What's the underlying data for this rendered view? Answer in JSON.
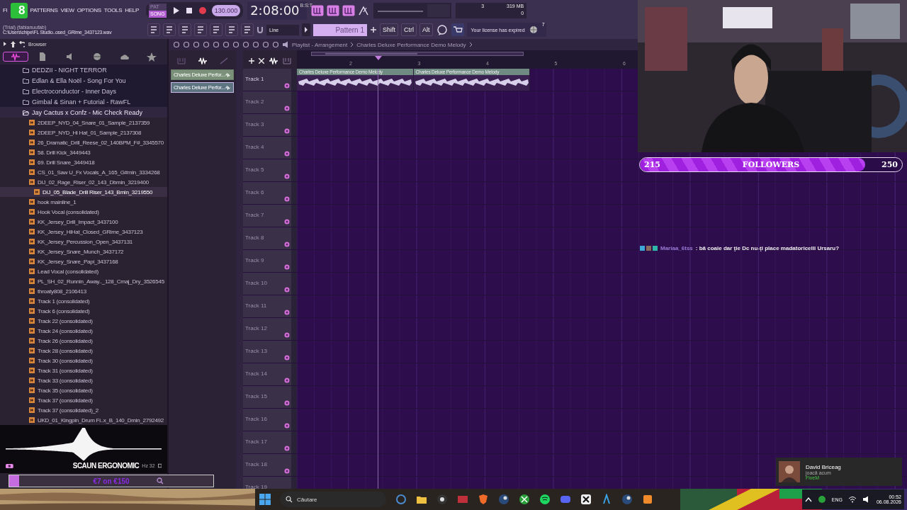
{
  "menu": {
    "items": [
      {
        "label": "FI"
      },
      {
        "label": "8",
        "kind": "logo"
      },
      {
        "label": "PATTERNS"
      },
      {
        "label": "VIEW"
      },
      {
        "label": "OPTIONS"
      },
      {
        "label": "TOOLS"
      },
      {
        "label": "HELP"
      }
    ]
  },
  "transport": {
    "modes": [
      {
        "label": "PAT",
        "selected": false
      },
      {
        "label": "SONG",
        "selected": true
      }
    ],
    "tempo": "130.000",
    "time": "2:08:00",
    "time_unit": "B:S:T"
  },
  "monitor": {
    "voices": "3",
    "memory": "319 MB",
    "polyphony": "0"
  },
  "info": {
    "hint": "(Trial) (fabianuufab)",
    "file": "C:\\Users\\chipe\\FL Studio..osed_GRime_3437123.wav"
  },
  "snap": "Line",
  "pattern": "Pattern 1",
  "modifier_keys": [
    "Shift",
    "Ctrl",
    "Alt"
  ],
  "news": {
    "text": "Your license has expired",
    "count": "7"
  },
  "browser": {
    "title": "Browser",
    "tabs": [
      {
        "selected": true
      },
      {
        "selected": false
      },
      {
        "selected": false
      },
      {
        "selected": false
      },
      {
        "selected": false
      },
      {
        "selected": false
      }
    ],
    "tree": [
      {
        "name": "DEDZII - NIGHT TERROR",
        "expanded": false
      },
      {
        "name": "Edlan & Ella Noël - Song For You",
        "expanded": false
      },
      {
        "name": "Electroconductor - Inner Days",
        "expanded": false
      },
      {
        "name": "Gimbal & Sinan + Futorial - RawFL",
        "expanded": false
      },
      {
        "name": "Jay Cactus x Confz - Mic Check Ready",
        "expanded": true,
        "children": [
          {
            "name": "2DEEP_NYD_04_Snare_01_Sample_2137359",
            "selected": false
          },
          {
            "name": "2DEEP_NYD_Hi Hat_01_Sample_2137308",
            "selected": false
          },
          {
            "name": "26_Dramatic_Drill_Reese_02_140BPM_F#_3345570",
            "selected": false
          },
          {
            "name": "58. Drill Kick_3449443",
            "selected": false
          },
          {
            "name": "69. Drill Snare_3449418",
            "selected": false
          },
          {
            "name": "CS_01_Saw U_Fx Vocals_A_165_G#min_3334268",
            "selected": false
          },
          {
            "name": "DIJ_02_Rage_Riser_02_143_Dbmin_3219400",
            "selected": false
          },
          {
            "name": "DIJ_05_Blade_Drill Riser_143_Bmin_3219550",
            "selected": true
          },
          {
            "name": "hook mainline_1",
            "selected": false
          },
          {
            "name": "Hook Vocal (consolidated)",
            "selected": false
          },
          {
            "name": "KK_Jersey_Drill_Impact_3437100",
            "selected": false
          },
          {
            "name": "KK_Jersey_HiHat_Closed_GRime_3437123",
            "selected": false
          },
          {
            "name": "KK_Jersey_Percussion_Open_3437131",
            "selected": false
          },
          {
            "name": "KK_Jersey_Snare_Munch_3437172",
            "selected": false
          },
          {
            "name": "KK_Jersey_Snare_Papi_3437168",
            "selected": false
          },
          {
            "name": "Lead Vocal (consolidated)",
            "selected": false
          },
          {
            "name": "PL_SH_02_Runnin_Away.._128_Cmaj_Dry_3526545",
            "selected": false
          },
          {
            "name": "throaty808_2106413",
            "selected": false
          },
          {
            "name": "Track 1 (consolidated)",
            "selected": false
          },
          {
            "name": "Track 6 (consolidated)",
            "selected": false
          },
          {
            "name": "Track 22 (consolidated)",
            "selected": false
          },
          {
            "name": "Track 24 (consolidated)",
            "selected": false
          },
          {
            "name": "Track 26 (consolidated)",
            "selected": false
          },
          {
            "name": "Track 28 (consolidated)",
            "selected": false
          },
          {
            "name": "Track 30 (consolidated)",
            "selected": false
          },
          {
            "name": "Track 31 (consolidated)",
            "selected": false
          },
          {
            "name": "Track 33 (consolidated)",
            "selected": false
          },
          {
            "name": "Track 35 (consolidated)",
            "selected": false
          },
          {
            "name": "Track 37 (consolidated)",
            "selected": false
          },
          {
            "name": "Track 37 (consolidated)_2",
            "selected": false
          },
          {
            "name": "UKD_01_Kingpin_Drum Fi..x_B_140_Dmin_2792492",
            "selected": false
          }
        ]
      }
    ]
  },
  "preview": {
    "caption": "SCAUN ERGONOMIC",
    "info": "Hz 32"
  },
  "goal_bar": {
    "text": "€7 on €150",
    "level": 0.05
  },
  "playlist": {
    "breadcrumb": [
      "Playlist - Arrangement",
      "Charles Deluxe Performance Demo Melody"
    ],
    "patterns": [
      {
        "name": "Charles Deluxe Perfor...",
        "selected": false
      },
      {
        "name": "Charles Deluxe Perfor...",
        "selected": true
      }
    ],
    "bars": [
      "2",
      "3",
      "4",
      "5",
      "6"
    ],
    "tracks": [
      {
        "name": "Track 1",
        "clips": [
          "Charles Deluxe Performance Demo Melody",
          "Charles Deluxe Performance Demo Melody"
        ]
      },
      {
        "name": "Track 2"
      },
      {
        "name": "Track 3"
      },
      {
        "name": "Track 4"
      },
      {
        "name": "Track 5"
      },
      {
        "name": "Track 6"
      },
      {
        "name": "Track 7"
      },
      {
        "name": "Track 8"
      },
      {
        "name": "Track 9"
      },
      {
        "name": "Track 10"
      },
      {
        "name": "Track 11"
      },
      {
        "name": "Track 12"
      },
      {
        "name": "Track 13"
      },
      {
        "name": "Track 14"
      },
      {
        "name": "Track 15"
      },
      {
        "name": "Track 16"
      },
      {
        "name": "Track 17"
      },
      {
        "name": "Track 18"
      },
      {
        "name": "Track 19"
      }
    ]
  },
  "followers": {
    "current": "215",
    "label": "FOLLOWERS",
    "goal": "250",
    "level": 0.86
  },
  "chat": [
    {
      "user": "Mariaa_6tss",
      "message": ": bă coaie dar ţie Dc nu-ţi place madatoricelli Ursaru?"
    }
  ],
  "notification": {
    "name": "David Briceag",
    "status": "joacă acum",
    "game": "FiveM"
  },
  "taskbar": {
    "search": "Căutare",
    "language": "ENG",
    "time": "00:52",
    "date": "06.08.2026"
  }
}
